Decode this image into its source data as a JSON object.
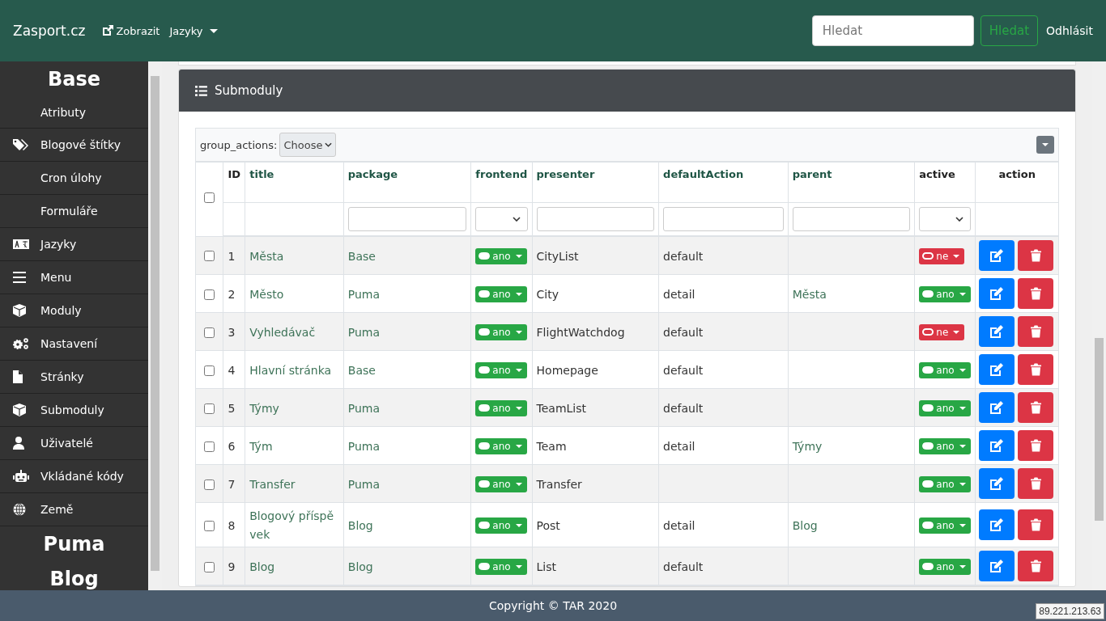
{
  "navbar": {
    "brand": "Zasport.cz",
    "links": [
      {
        "label": "Zobrazit",
        "kind": "external"
      },
      {
        "label": "Jazyky",
        "kind": "dropdown"
      }
    ],
    "search": {
      "placeholder": "Hledat"
    },
    "search_button": "Hledat",
    "logout": "Odhlásit"
  },
  "sidebar": {
    "sections": [
      {
        "title": "Base",
        "items": [
          {
            "label": "Atributy",
            "kind": "plain"
          },
          {
            "label": "Blogové štítky",
            "kind": "tags"
          },
          {
            "label": "Cron úlohy",
            "kind": "plain"
          },
          {
            "label": "Formuláře",
            "kind": "plain"
          },
          {
            "label": "Jazyky",
            "kind": "language"
          },
          {
            "label": "Menu",
            "kind": "menu"
          },
          {
            "label": "Moduly",
            "kind": "cube"
          },
          {
            "label": "Nastavení",
            "kind": "gears"
          },
          {
            "label": "Stránky",
            "kind": "page"
          },
          {
            "label": "Submoduly",
            "kind": "cube"
          },
          {
            "label": "Uživatelé",
            "kind": "user"
          },
          {
            "label": "Vkládané kódy",
            "kind": "robot"
          },
          {
            "label": "Země",
            "kind": "globe"
          }
        ]
      },
      {
        "title": "Puma"
      },
      {
        "title": "Blog"
      }
    ]
  },
  "panel": {
    "title": "Submoduly",
    "group_actions_label": "group_actions:",
    "group_actions_select": "Choose",
    "table": {
      "select_all_checked": false,
      "columns": [
        {
          "label": "ID",
          "sortable": false,
          "kind": "none"
        },
        {
          "label": "title",
          "sortable": true,
          "kind": "none"
        },
        {
          "label": "package",
          "sortable": true,
          "kind": "text"
        },
        {
          "label": "frontend",
          "sortable": true,
          "kind": "select"
        },
        {
          "label": "presenter",
          "sortable": true,
          "kind": "text"
        },
        {
          "label": "defaultAction",
          "sortable": true,
          "kind": "text"
        },
        {
          "label": "parent",
          "sortable": true,
          "kind": "text"
        },
        {
          "label": "active",
          "sortable": false,
          "kind": "select"
        },
        {
          "label": "action",
          "sortable": false,
          "kind": "none"
        }
      ],
      "rows": [
        {
          "checked": false,
          "id": "1",
          "title": "Města",
          "package": "Base",
          "frontend": {
            "on": true,
            "label": "ano"
          },
          "presenter": "CityList",
          "defaultAction": "default",
          "active": {
            "on": false,
            "label": "ne"
          }
        },
        {
          "checked": false,
          "id": "2",
          "title": "Město",
          "package": "Puma",
          "frontend": {
            "on": true,
            "label": "ano"
          },
          "presenter": "City",
          "defaultAction": "detail",
          "parent": "Města",
          "active": {
            "on": true,
            "label": "ano"
          }
        },
        {
          "checked": false,
          "id": "3",
          "title": "Vyhledávač",
          "package": "Puma",
          "frontend": {
            "on": true,
            "label": "ano"
          },
          "presenter": "FlightWatchdog",
          "defaultAction": "default",
          "active": {
            "on": false,
            "label": "ne"
          }
        },
        {
          "checked": false,
          "id": "4",
          "title": "Hlavní stránka",
          "package": "Base",
          "frontend": {
            "on": true,
            "label": "ano"
          },
          "presenter": "Homepage",
          "defaultAction": "default",
          "active": {
            "on": true,
            "label": "ano"
          }
        },
        {
          "checked": false,
          "id": "5",
          "title": "Týmy",
          "package": "Puma",
          "frontend": {
            "on": true,
            "label": "ano"
          },
          "presenter": "TeamList",
          "defaultAction": "default",
          "active": {
            "on": true,
            "label": "ano"
          }
        },
        {
          "checked": false,
          "id": "6",
          "title": "Tým",
          "package": "Puma",
          "frontend": {
            "on": true,
            "label": "ano"
          },
          "presenter": "Team",
          "defaultAction": "detail",
          "parent": "Týmy",
          "active": {
            "on": true,
            "label": "ano"
          }
        },
        {
          "checked": false,
          "id": "7",
          "title": "Transfer",
          "package": "Puma",
          "frontend": {
            "on": true,
            "label": "ano"
          },
          "presenter": "Transfer",
          "active": {
            "on": true,
            "label": "ano"
          }
        },
        {
          "checked": false,
          "id": "8",
          "title": "Blogový příspěvek",
          "package": "Blog",
          "frontend": {
            "on": true,
            "label": "ano"
          },
          "presenter": "Post",
          "defaultAction": "detail",
          "parent": "Blog",
          "active": {
            "on": true,
            "label": "ano"
          }
        },
        {
          "checked": false,
          "id": "9",
          "title": "Blog",
          "package": "Blog",
          "frontend": {
            "on": true,
            "label": "ano"
          },
          "presenter": "List",
          "defaultAction": "default",
          "active": {
            "on": true,
            "label": "ano"
          }
        }
      ]
    }
  },
  "footer": {
    "copyright": "Copyright © TAR 2020"
  },
  "tooltip": "89.221.213.63"
}
